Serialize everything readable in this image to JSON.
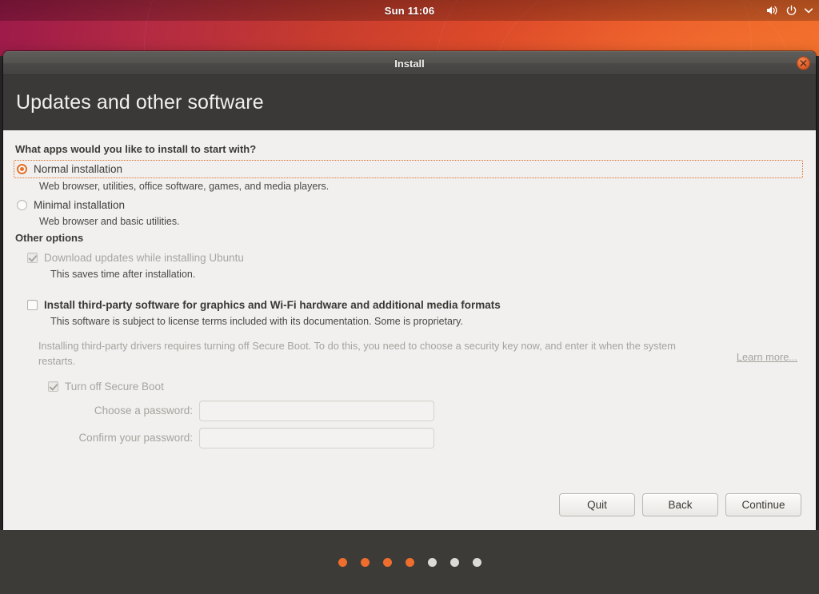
{
  "topbar": {
    "clock": "Sun 11:06",
    "icons": [
      "volume-icon",
      "power-icon",
      "chevron-down-icon"
    ]
  },
  "window": {
    "title": "Install",
    "close_label": "×"
  },
  "page": {
    "title": "Updates and other software"
  },
  "apps_section": {
    "heading": "What apps would you like to install to start with?",
    "options": [
      {
        "label": "Normal installation",
        "description": "Web browser, utilities, office software, games, and media players.",
        "selected": true,
        "focused": true
      },
      {
        "label": "Minimal installation",
        "description": "Web browser and basic utilities.",
        "selected": false,
        "focused": false
      }
    ]
  },
  "other_options": {
    "heading": "Other options",
    "download_updates": {
      "label": "Download updates while installing Ubuntu",
      "note": "This saves time after installation.",
      "checked": true,
      "enabled": false
    },
    "third_party": {
      "label": "Install third-party software for graphics and Wi-Fi hardware and additional media formats",
      "note": "This software is subject to license terms included with its documentation. Some is proprietary.",
      "checked": false,
      "enabled": true
    },
    "secure_boot_info": "Installing third-party drivers requires turning off Secure Boot. To do this, you need to choose a security key now, and enter it when the system restarts.",
    "learn_more_label": "Learn more...",
    "turn_off_secure_boot": {
      "label": "Turn off Secure Boot",
      "checked": true,
      "enabled": false
    },
    "password_fields": [
      {
        "label": "Choose a password:",
        "value": "",
        "placeholder": ""
      },
      {
        "label": "Confirm your password:",
        "value": "",
        "placeholder": ""
      }
    ]
  },
  "actions": {
    "quit_label": "Quit",
    "back_label": "Back",
    "continue_label": "Continue"
  },
  "progress": {
    "total_steps": 7,
    "completed_steps": 4,
    "active_color": "#ef6e2e",
    "inactive_color": "#dcdad6"
  },
  "colors": {
    "accent": "#e5702b",
    "header_band": "#3a3937",
    "content_bg": "#f1f0ee",
    "footer_bg": "#3d3b38"
  }
}
